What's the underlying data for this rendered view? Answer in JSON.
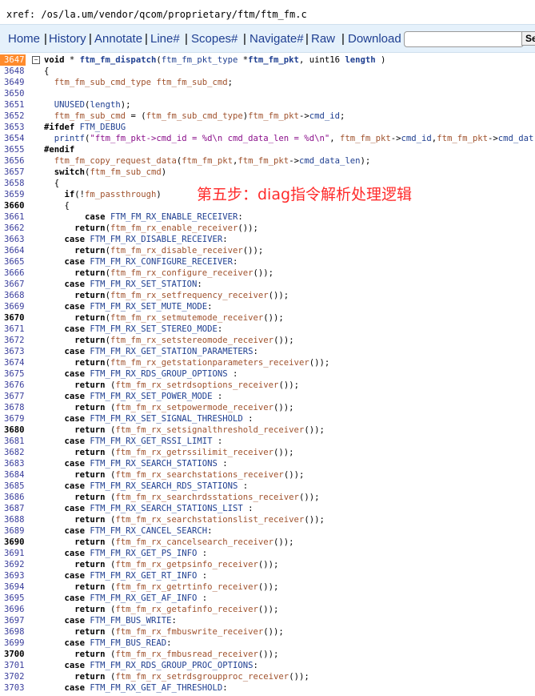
{
  "header": {
    "xref_path": "xref: /os/la.um/vendor/qcom/proprietary/ftm/ftm_fm.c"
  },
  "menu": {
    "items": [
      "Home",
      "History",
      "Annotate",
      "Line#",
      "Scopes#",
      "Navigate#",
      "Raw",
      "Download"
    ],
    "search_placeholder": "",
    "search_button_label": "Se"
  },
  "annotation": {
    "text": "第五步：diag指令解析处理逻辑"
  },
  "code": {
    "active_line": "3647",
    "lines": [
      {
        "n": "3647",
        "t": "void * ftm_fm_dispatch(ftm_fm_pkt_type *ftm_fm_pkt, uint16 length )"
      },
      {
        "n": "3648",
        "t": "{"
      },
      {
        "n": "3649",
        "t": "  ftm_fm_sub_cmd_type ftm_fm_sub_cmd;"
      },
      {
        "n": "3650",
        "t": ""
      },
      {
        "n": "3651",
        "t": "  UNUSED(length);"
      },
      {
        "n": "3652",
        "t": "  ftm_fm_sub_cmd = (ftm_fm_sub_cmd_type)ftm_fm_pkt->cmd_id;"
      },
      {
        "n": "3653",
        "t": "#ifdef FTM_DEBUG"
      },
      {
        "n": "3654",
        "t": "  printf(\"ftm_fm_pkt->cmd_id = %d\\n cmd_data_len = %d\\n\", ftm_fm_pkt->cmd_id,ftm_fm_pkt->cmd_dat"
      },
      {
        "n": "3655",
        "t": "#endif"
      },
      {
        "n": "3656",
        "t": "  ftm_fm_copy_request_data(ftm_fm_pkt,ftm_fm_pkt->cmd_data_len);"
      },
      {
        "n": "3657",
        "t": "  switch(ftm_fm_sub_cmd)"
      },
      {
        "n": "3658",
        "t": "  {"
      },
      {
        "n": "3659",
        "t": "    if(!fm_passthrough)"
      },
      {
        "n": "3660",
        "t": "    {"
      },
      {
        "n": "3661",
        "t": "        case FTM_FM_RX_ENABLE_RECEIVER:"
      },
      {
        "n": "3662",
        "t": "      return(ftm_fm_rx_enable_receiver());"
      },
      {
        "n": "3663",
        "t": "    case FTM_FM_RX_DISABLE_RECEIVER:"
      },
      {
        "n": "3664",
        "t": "      return(ftm_fm_rx_disable_receiver());"
      },
      {
        "n": "3665",
        "t": "    case FTM_FM_RX_CONFIGURE_RECEIVER:"
      },
      {
        "n": "3666",
        "t": "      return(ftm_fm_rx_configure_receiver());"
      },
      {
        "n": "3667",
        "t": "    case FTM_FM_RX_SET_STATION:"
      },
      {
        "n": "3668",
        "t": "      return(ftm_fm_rx_setfrequency_receiver());"
      },
      {
        "n": "3669",
        "t": "    case FTM_FM_RX_SET_MUTE_MODE:"
      },
      {
        "n": "3670",
        "t": "      return(ftm_fm_rx_setmutemode_receiver());"
      },
      {
        "n": "3671",
        "t": "    case FTM_FM_RX_SET_STEREO_MODE:"
      },
      {
        "n": "3672",
        "t": "      return(ftm_fm_rx_setstereomode_receiver());"
      },
      {
        "n": "3673",
        "t": "    case FTM_FM_RX_GET_STATION_PARAMETERS:"
      },
      {
        "n": "3674",
        "t": "      return(ftm_fm_rx_getstationparameters_receiver());"
      },
      {
        "n": "3675",
        "t": "    case FTM_FM_RX_RDS_GROUP_OPTIONS :"
      },
      {
        "n": "3676",
        "t": "      return (ftm_fm_rx_setrdsoptions_receiver());"
      },
      {
        "n": "3677",
        "t": "    case FTM_FM_RX_SET_POWER_MODE :"
      },
      {
        "n": "3678",
        "t": "      return (ftm_fm_rx_setpowermode_receiver());"
      },
      {
        "n": "3679",
        "t": "    case FTM_FM_RX_SET_SIGNAL_THRESHOLD :"
      },
      {
        "n": "3680",
        "t": "      return (ftm_fm_rx_setsignalthreshold_receiver());"
      },
      {
        "n": "3681",
        "t": "    case FTM_FM_RX_GET_RSSI_LIMIT :"
      },
      {
        "n": "3682",
        "t": "      return (ftm_fm_rx_getrssilimit_receiver());"
      },
      {
        "n": "3683",
        "t": "    case FTM_FM_RX_SEARCH_STATIONS :"
      },
      {
        "n": "3684",
        "t": "      return (ftm_fm_rx_searchstations_receiver());"
      },
      {
        "n": "3685",
        "t": "    case FTM_FM_RX_SEARCH_RDS_STATIONS :"
      },
      {
        "n": "3686",
        "t": "      return (ftm_fm_rx_searchrdsstations_receiver());"
      },
      {
        "n": "3687",
        "t": "    case FTM_FM_RX_SEARCH_STATIONS_LIST :"
      },
      {
        "n": "3688",
        "t": "      return (ftm_fm_rx_searchstationslist_receiver());"
      },
      {
        "n": "3689",
        "t": "    case FTM_FM_RX_CANCEL_SEARCH:"
      },
      {
        "n": "3690",
        "t": "      return (ftm_fm_rx_cancelsearch_receiver());"
      },
      {
        "n": "3691",
        "t": "    case FTM_FM_RX_GET_PS_INFO :"
      },
      {
        "n": "3692",
        "t": "      return (ftm_fm_rx_getpsinfo_receiver());"
      },
      {
        "n": "3693",
        "t": "    case FTM_FM_RX_GET_RT_INFO :"
      },
      {
        "n": "3694",
        "t": "      return (ftm_fm_rx_getrtinfo_receiver());"
      },
      {
        "n": "3695",
        "t": "    case FTM_FM_RX_GET_AF_INFO :"
      },
      {
        "n": "3696",
        "t": "      return (ftm_fm_rx_getafinfo_receiver());"
      },
      {
        "n": "3697",
        "t": "    case FTM_FM_BUS_WRITE:"
      },
      {
        "n": "3698",
        "t": "      return (ftm_fm_rx_fmbuswrite_receiver());"
      },
      {
        "n": "3699",
        "t": "    case FTM_FM_BUS_READ:"
      },
      {
        "n": "3700",
        "t": "      return (ftm_fm_rx_fmbusread_receiver());"
      },
      {
        "n": "3701",
        "t": "    case FTM_FM_RX_RDS_GROUP_PROC_OPTIONS:"
      },
      {
        "n": "3702",
        "t": "      return (ftm_fm_rx_setrdsgroupproc_receiver());"
      },
      {
        "n": "3703",
        "t": "    case FTM_FM_RX_GET_AF_THRESHOLD:"
      }
    ]
  }
}
